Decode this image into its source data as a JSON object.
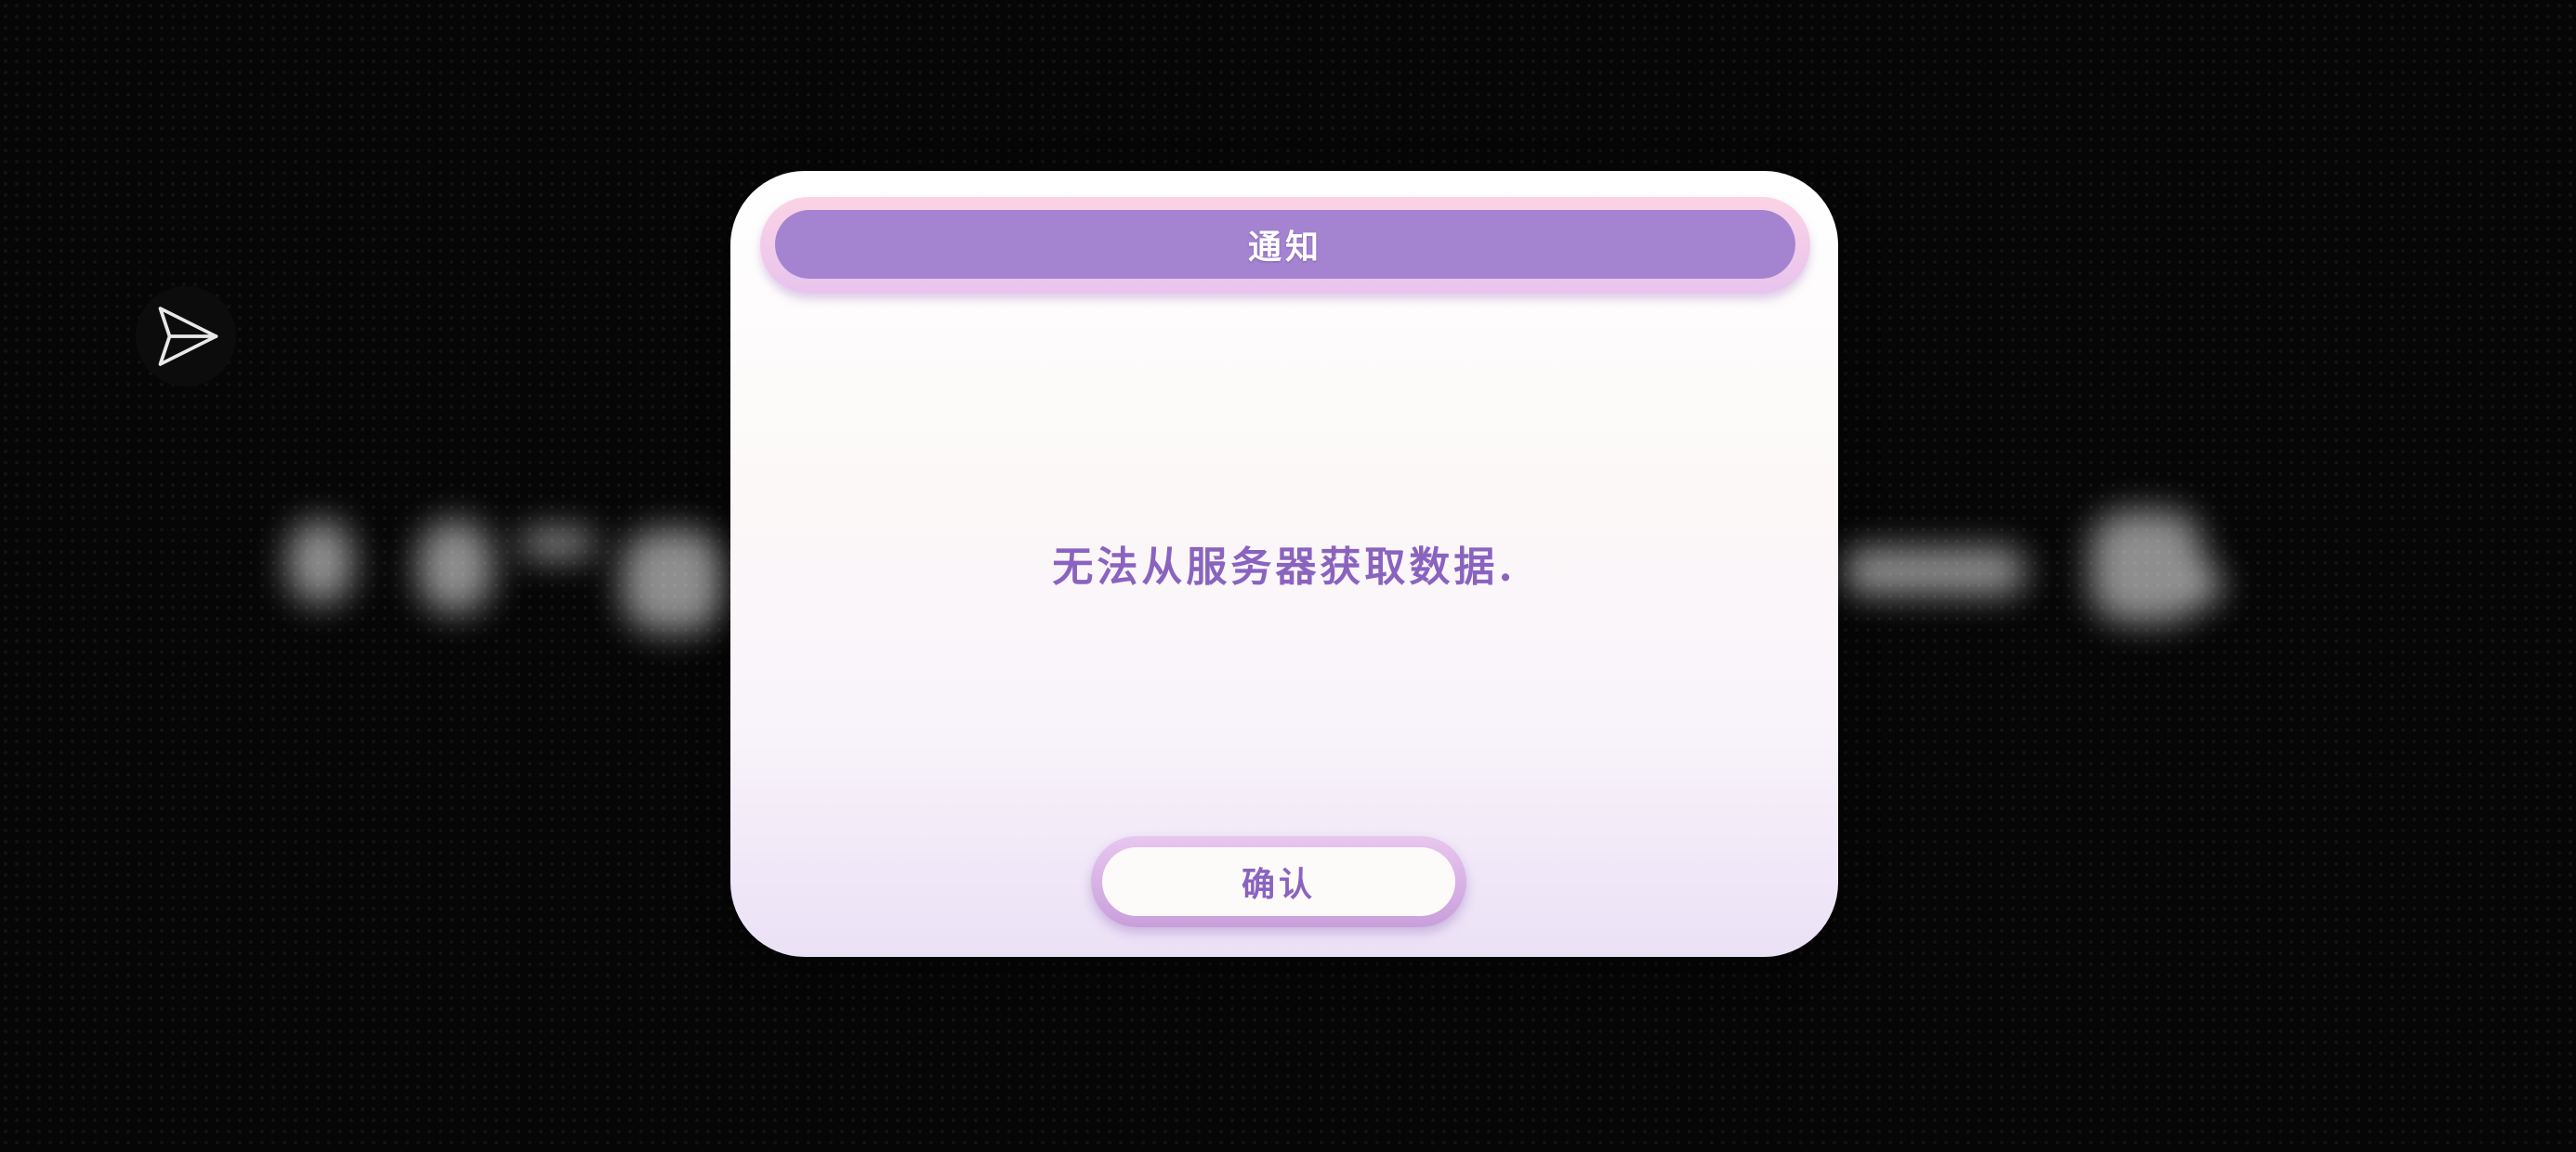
{
  "dialog": {
    "title": "通知",
    "message": "无法从服务器获取数据.",
    "confirm_label": "确认"
  },
  "icons": {
    "send": "paper-plane-icon"
  },
  "colors": {
    "accent": "#a484d0",
    "message_text": "#8a63bf",
    "background": "#060606"
  }
}
